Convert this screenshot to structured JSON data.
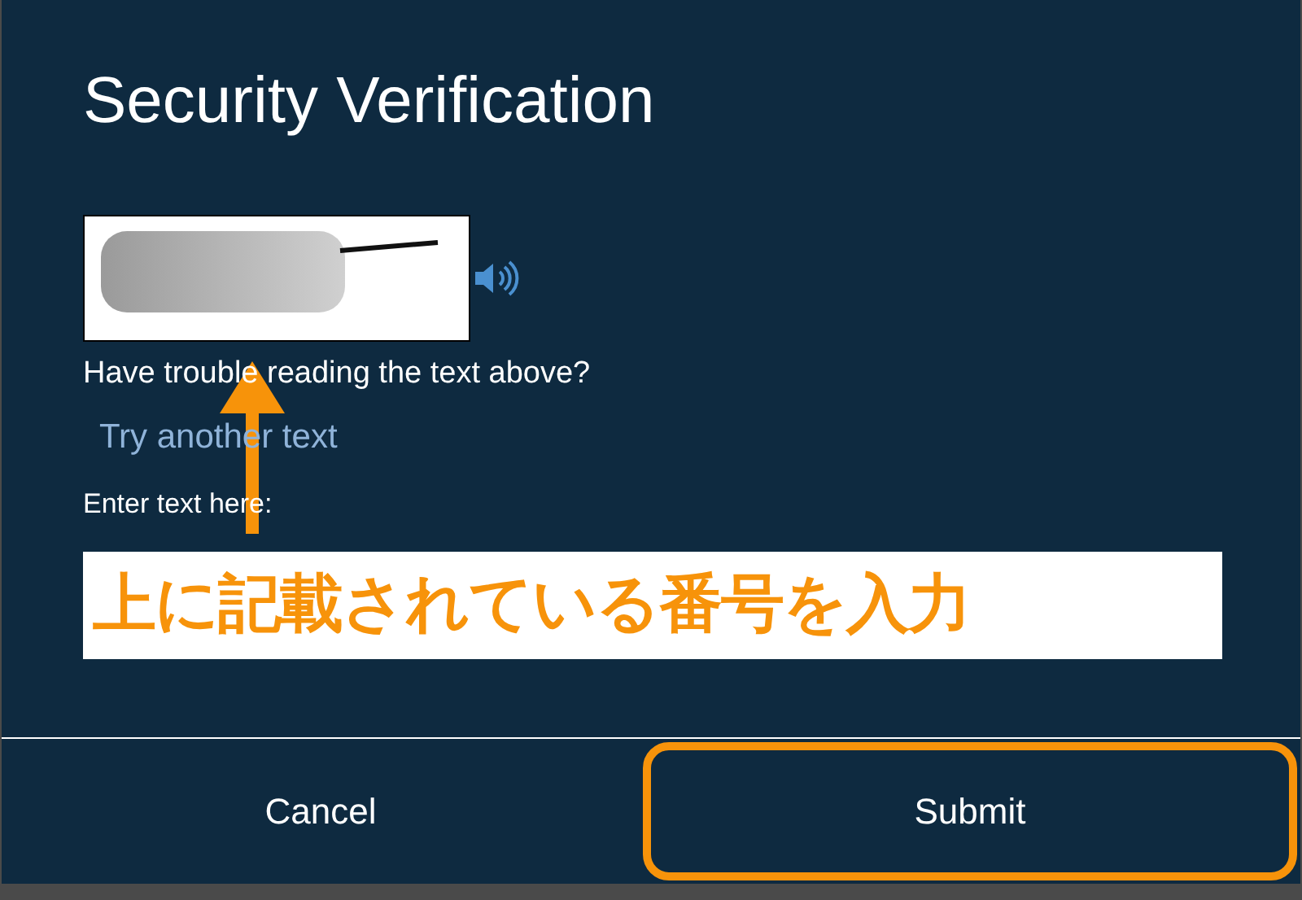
{
  "dialog": {
    "title": "Security Verification",
    "help_text": "Have trouble reading the text above?",
    "retry_link": "Try another text",
    "input_label": "Enter text here:",
    "buttons": [
      {
        "label": "Cancel",
        "highlighted": false
      },
      {
        "label": "Submit",
        "highlighted": true
      }
    ]
  },
  "annotation": {
    "text": "上に記載されている番号を入力",
    "arrow": true
  }
}
